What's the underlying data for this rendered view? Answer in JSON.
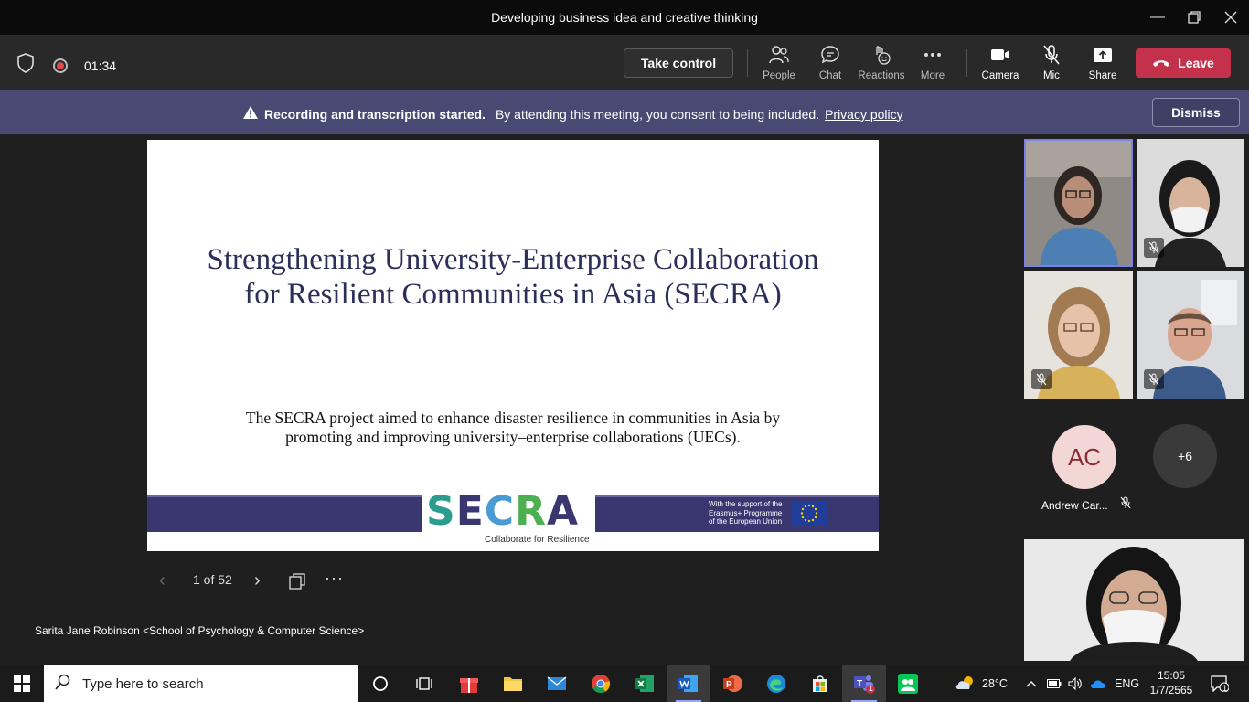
{
  "window": {
    "title": "Developing business idea and creative thinking"
  },
  "toolbar": {
    "timer": "01:34",
    "take_control": "Take control",
    "buttons": [
      {
        "label": "People",
        "icon": "people-icon"
      },
      {
        "label": "Chat",
        "icon": "chat-icon"
      },
      {
        "label": "Reactions",
        "icon": "reactions-icon"
      },
      {
        "label": "More",
        "icon": "more-icon"
      },
      {
        "label": "Camera",
        "icon": "camera-icon"
      },
      {
        "label": "Mic",
        "icon": "mic-off-icon"
      },
      {
        "label": "Share",
        "icon": "share-icon"
      }
    ],
    "leave": "Leave"
  },
  "banner": {
    "bold": "Recording and transcription started.",
    "text": "By attending this meeting, you consent to being included.",
    "link": "Privacy policy",
    "dismiss": "Dismiss"
  },
  "slide": {
    "title": "Strengthening University-Enterprise Collaboration for Resilient Communities in Asia (SECRA)",
    "description": "The SECRA project aimed to enhance disaster resilience in communities in Asia by promoting and improving university–enterprise collaborations (UECs).",
    "logo_letters": [
      "S",
      "E",
      "C",
      "R",
      "A"
    ],
    "logo_colors": [
      "#2a9d8f",
      "#3a3670",
      "#4a9bd4",
      "#4caf50",
      "#3a3670"
    ],
    "tagline": "Collaborate for Resilience",
    "eu_support": [
      "With the support of the",
      "Erasmus+ Programme",
      "of the European Union"
    ]
  },
  "slide_nav": {
    "page": "1 of 52"
  },
  "presenter": "Sarita Jane Robinson <School of Psychology & Computer Science>",
  "participants": {
    "initials": "AC",
    "name": "Andrew Car...",
    "overflow": "+6"
  },
  "taskbar": {
    "search_placeholder": "Type here to search",
    "weather": "28°C",
    "language": "ENG",
    "time": "15:05",
    "date": "1/7/2565",
    "notification_count": "1",
    "teams_badge": "1"
  },
  "colors": {
    "leave": "#c4314b",
    "banner": "#484a73",
    "accent": "#7b83eb"
  }
}
